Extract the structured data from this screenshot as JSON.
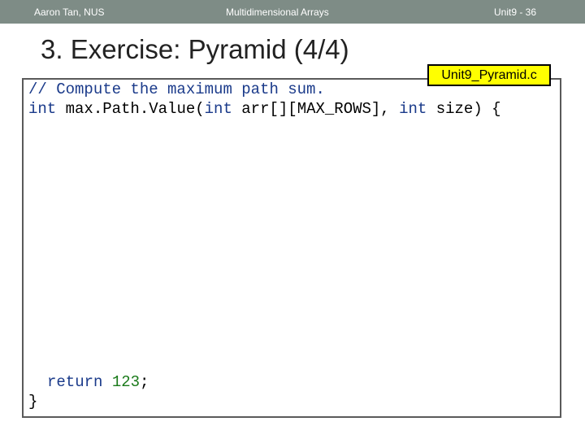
{
  "header": {
    "author": "Aaron Tan, NUS",
    "topic": "Multidimensional Arrays",
    "page": "Unit9 - 36"
  },
  "title": "3. Exercise: Pyramid (4/4)",
  "file_tag": "Unit9_Pyramid.c",
  "code": {
    "comment": "// Compute the maximum path sum.",
    "sig_kw1": "int",
    "sig_mid": " max.Path.Value(",
    "sig_kw2": "int",
    "sig_mid2": " arr[][MAX_ROWS], ",
    "sig_kw3": "int",
    "sig_end": " size) {",
    "ret_kw": "return",
    "ret_num": "123",
    "ret_end": ";",
    "close": "}"
  }
}
